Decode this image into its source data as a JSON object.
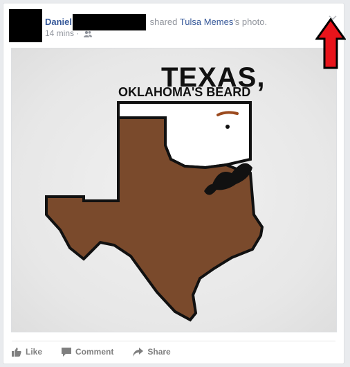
{
  "post": {
    "author": "Daniel",
    "shared_text": "shared",
    "page_name": "Tulsa Memes",
    "suffix": "'s photo.",
    "time": "14 mins",
    "separator": "·",
    "audience_icon": "friends-icon",
    "menu_icon": "chevron-down-icon"
  },
  "photo": {
    "title_line1": "TEXAS,",
    "title_line2": "OKLAHOMA'S BEARD"
  },
  "actions": {
    "like": "Like",
    "comment": "Comment",
    "share": "Share"
  },
  "colors": {
    "link": "#365899",
    "beard_brown": "#7a4a2c",
    "arrow_red": "#e8141b"
  }
}
